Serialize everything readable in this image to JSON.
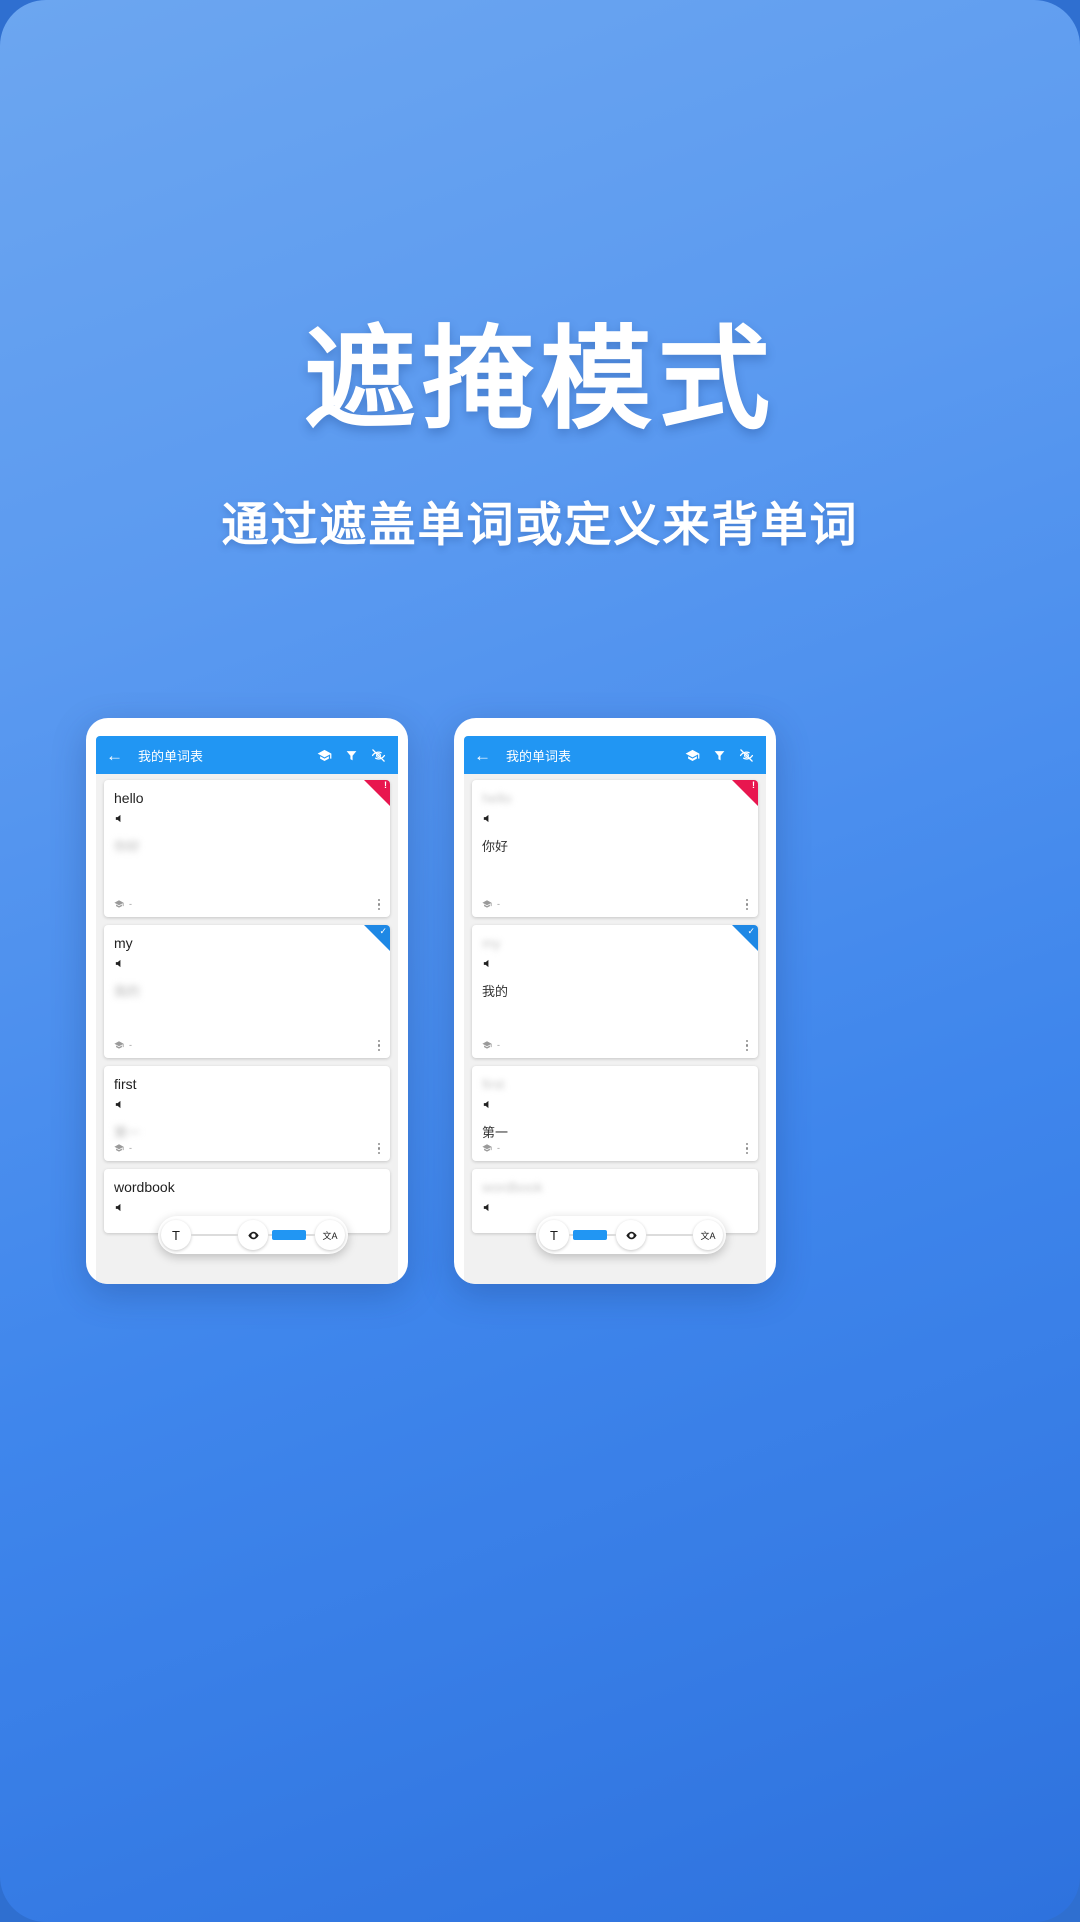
{
  "hero": {
    "title": "遮掩模式",
    "subtitle": "通过遮盖单词或定义来背单词"
  },
  "colors": {
    "background_top": "#6ca6f0",
    "background_bottom": "#2e72de",
    "appbar": "#2196f3",
    "accent": "#2196f3",
    "badge_alert": "#e8164f",
    "badge_done": "#1e88e5"
  },
  "phones": [
    {
      "name": "mask-definition-mode",
      "appbar": {
        "back_icon": "arrow-left-icon",
        "title": "我的单词表",
        "actions": [
          {
            "icon": "graduation-cap-icon",
            "name": "study-mode-button"
          },
          {
            "icon": "filter-icon",
            "name": "filter-button"
          },
          {
            "icon": "eye-off-icon",
            "name": "mask-toggle-button"
          }
        ]
      },
      "cards": [
        {
          "word": "hello",
          "word_masked": false,
          "definition": "你好",
          "definition_masked": true,
          "speaker_icon": "speaker-icon",
          "progress": "-",
          "badge": "alert",
          "badge_glyph": "!"
        },
        {
          "word": "my",
          "word_masked": false,
          "definition": "我的",
          "definition_masked": true,
          "speaker_icon": "speaker-icon",
          "progress": "-",
          "badge": "done",
          "badge_glyph": "✓"
        },
        {
          "word": "first",
          "word_masked": false,
          "definition": "第一",
          "definition_masked": true,
          "speaker_icon": "speaker-icon",
          "progress": "-",
          "badge": "none",
          "badge_glyph": ""
        },
        {
          "word": "wordbook",
          "word_masked": false,
          "definition": "",
          "definition_masked": true,
          "speaker_icon": "speaker-icon",
          "progress": "",
          "badge": "none",
          "badge_glyph": ""
        }
      ],
      "pill": {
        "left_label": "T",
        "middle_icon": "eye-icon",
        "right_icon": "translate-icon",
        "right_label": "文A",
        "selected_segment": "right"
      }
    },
    {
      "name": "mask-word-mode",
      "appbar": {
        "back_icon": "arrow-left-icon",
        "title": "我的单词表",
        "actions": [
          {
            "icon": "graduation-cap-icon",
            "name": "study-mode-button"
          },
          {
            "icon": "filter-icon",
            "name": "filter-button"
          },
          {
            "icon": "eye-off-icon",
            "name": "mask-toggle-button"
          }
        ]
      },
      "cards": [
        {
          "word": "hello",
          "word_masked": true,
          "definition": "你好",
          "definition_masked": false,
          "speaker_icon": "speaker-icon",
          "progress": "-",
          "badge": "alert",
          "badge_glyph": "!"
        },
        {
          "word": "my",
          "word_masked": true,
          "definition": "我的",
          "definition_masked": false,
          "speaker_icon": "speaker-icon",
          "progress": "-",
          "badge": "done",
          "badge_glyph": "✓"
        },
        {
          "word": "first",
          "word_masked": true,
          "definition": "第一",
          "definition_masked": false,
          "speaker_icon": "speaker-icon",
          "progress": "-",
          "badge": "none",
          "badge_glyph": ""
        },
        {
          "word": "wordbook",
          "word_masked": true,
          "definition": "",
          "definition_masked": false,
          "speaker_icon": "speaker-icon",
          "progress": "",
          "badge": "none",
          "badge_glyph": ""
        }
      ],
      "pill": {
        "left_label": "T",
        "middle_icon": "eye-icon",
        "right_icon": "translate-icon",
        "right_label": "文A",
        "selected_segment": "left"
      }
    }
  ]
}
